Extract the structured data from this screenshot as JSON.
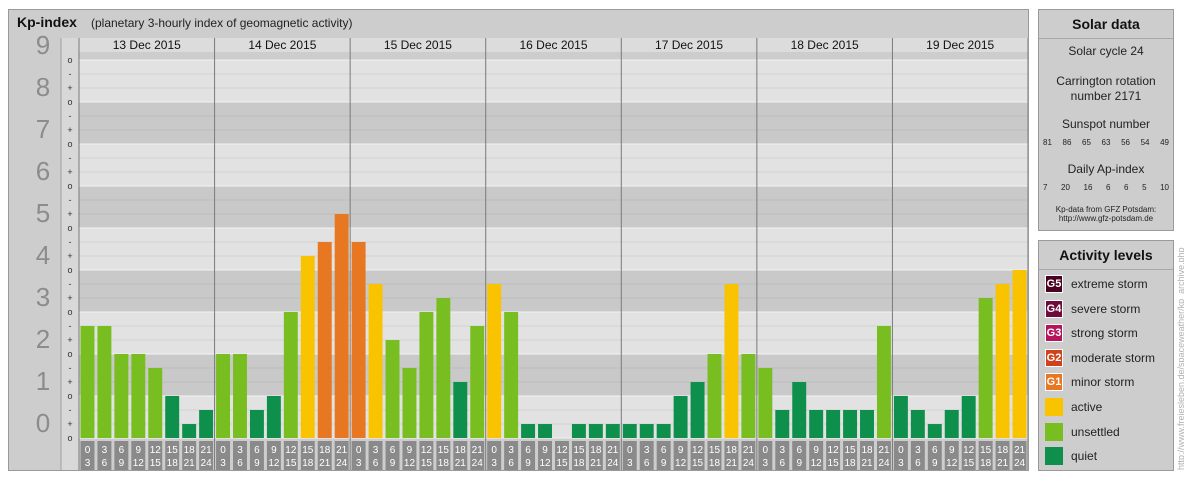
{
  "header": {
    "title": "Kp-index",
    "subtitle": "(planetary 3-hourly index of geomagnetic activity)"
  },
  "chart_data": {
    "type": "bar",
    "title": "Kp-index",
    "subtitle": "(planetary 3-hourly index of geomagnetic activity)",
    "ylim": [
      0,
      9
    ],
    "y_ticks": [
      "0",
      "1",
      "2",
      "3",
      "4",
      "5",
      "6",
      "7",
      "8",
      "9"
    ],
    "y_minor_ticks": [
      "o",
      "+",
      "-"
    ],
    "days": [
      "13 Dec 2015",
      "14 Dec 2015",
      "15 Dec 2015",
      "16 Dec 2015",
      "17 Dec 2015",
      "18 Dec 2015",
      "19 Dec 2015"
    ],
    "interval_start": [
      "0",
      "3",
      "6",
      "9",
      "12",
      "15",
      "18",
      "21"
    ],
    "interval_end": [
      "3",
      "6",
      "9",
      "12",
      "15",
      "18",
      "21",
      "24"
    ],
    "values": [
      [
        2.667,
        2.667,
        2.0,
        2.0,
        1.667,
        1.0,
        0.333,
        0.667
      ],
      [
        2.0,
        2.0,
        0.667,
        1.0,
        3.0,
        4.333,
        4.667,
        5.333
      ],
      [
        4.667,
        3.667,
        2.333,
        1.667,
        3.0,
        3.333,
        1.333,
        2.667
      ],
      [
        3.667,
        3.0,
        0.333,
        0.333,
        0.0,
        0.333,
        0.333,
        0.333
      ],
      [
        0.333,
        0.333,
        0.333,
        1.0,
        1.333,
        2.0,
        3.667,
        2.0
      ],
      [
        1.667,
        0.667,
        1.333,
        0.667,
        0.667,
        0.667,
        0.667,
        2.667
      ],
      [
        1.0,
        0.667,
        0.333,
        0.667,
        1.0,
        3.333,
        3.667,
        4.0
      ]
    ],
    "levels": [
      [
        2,
        2,
        2,
        2,
        2,
        1,
        1,
        1
      ],
      [
        2,
        2,
        1,
        1,
        2,
        3,
        4,
        4
      ],
      [
        4,
        3,
        2,
        2,
        2,
        2,
        1,
        2
      ],
      [
        3,
        2,
        1,
        1,
        1,
        1,
        1,
        1
      ],
      [
        1,
        1,
        1,
        1,
        1,
        2,
        3,
        2
      ],
      [
        2,
        1,
        1,
        1,
        1,
        1,
        1,
        2
      ],
      [
        1,
        1,
        1,
        1,
        1,
        2,
        3,
        3
      ]
    ],
    "level_colors": {
      "1": "#0f8f4c",
      "2": "#78be20",
      "3": "#f9c300",
      "4": "#e87722",
      "5": "#d0431a",
      "6": "#b5145a",
      "7": "#6e0a3c",
      "8": "#4a0322"
    },
    "grid": true
  },
  "solar": {
    "title": "Solar data",
    "cycle_text": "Solar cycle 24",
    "carrington_line1": "Carrington rotation",
    "carrington_line2": "number 2171",
    "sunspot_label": "Sunspot number",
    "sunspot_values": [
      "81",
      "86",
      "65",
      "63",
      "56",
      "54",
      "49"
    ],
    "ap_label": "Daily Ap-index",
    "ap_values": [
      "7",
      "20",
      "16",
      "6",
      "6",
      "5",
      "10"
    ],
    "credit_line1": "Kp-data from GFZ Potsdam:",
    "credit_line2": "http://www.gfz-potsdam.de"
  },
  "activity": {
    "title": "Activity levels",
    "items": [
      {
        "code": "G5",
        "label": "extreme storm",
        "color": "#4a0322"
      },
      {
        "code": "G4",
        "label": "severe storm",
        "color": "#6e0a3c"
      },
      {
        "code": "G3",
        "label": "strong storm",
        "color": "#b5145a"
      },
      {
        "code": "G2",
        "label": "moderate storm",
        "color": "#d0431a"
      },
      {
        "code": "G1",
        "label": "minor storm",
        "color": "#e87722"
      },
      {
        "code": "",
        "label": "active",
        "color": "#f9c300"
      },
      {
        "code": "",
        "label": "unsettled",
        "color": "#78be20"
      },
      {
        "code": "",
        "label": "quiet",
        "color": "#0f8f4c"
      }
    ]
  },
  "watermark": "http://www.freiesleben.de/spaceweather/kp_archive.php"
}
